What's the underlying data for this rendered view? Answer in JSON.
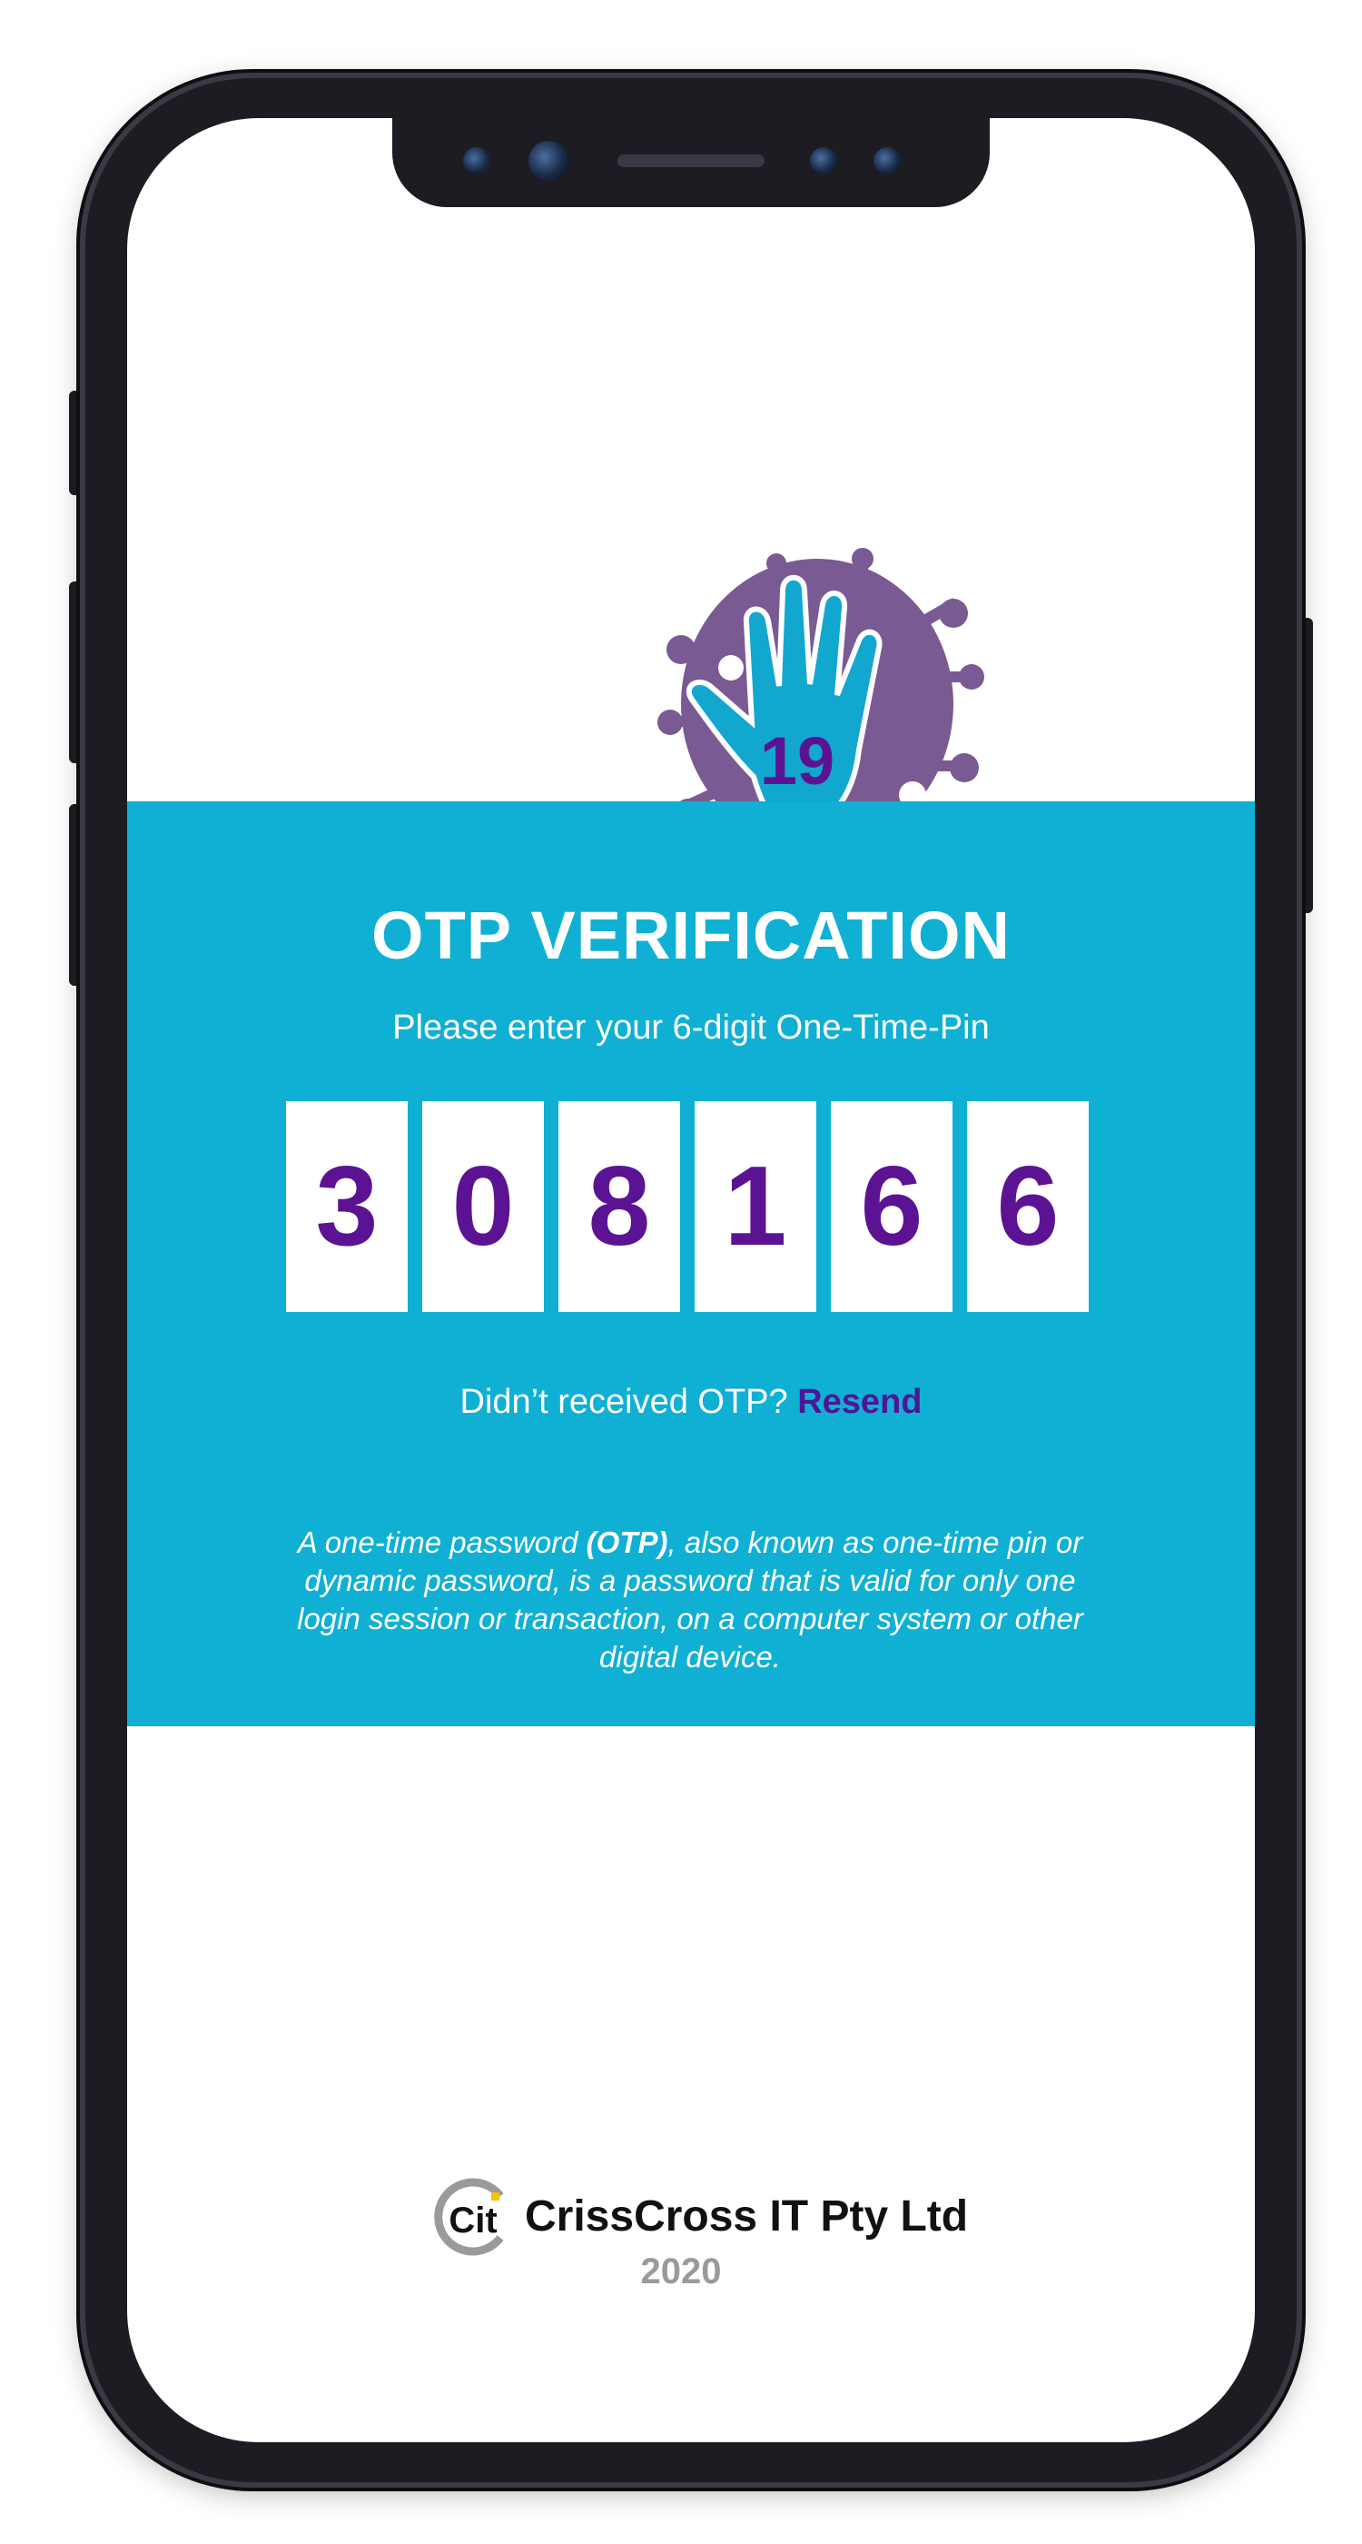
{
  "logo": {
    "icon": "covid-hand-logo-icon",
    "badge_text": "19"
  },
  "otp": {
    "title": "OTP VERIFICATION",
    "subtitle": "Please enter your 6-digit One-Time-Pin",
    "digits": [
      "3",
      "0",
      "8",
      "1",
      "6",
      "6"
    ],
    "resend_prompt": "Didn’t received OTP?",
    "resend_link": "Resend",
    "info_before": "A one-time password ",
    "info_bold": "(OTP)",
    "info_after": ", also known as one-time pin or dynamic password, is a password that is valid for only one login session or transaction, on a computer system or other digital device."
  },
  "footer": {
    "company_logo_text": "Cit",
    "company_name": "CrissCross IT Pty Ltd",
    "year": "2020"
  },
  "colors": {
    "panel": "#0fb0d3",
    "digit": "#5c1393",
    "logo_purple": "#7a5a93",
    "logo_cyan": "#12a7cf"
  }
}
